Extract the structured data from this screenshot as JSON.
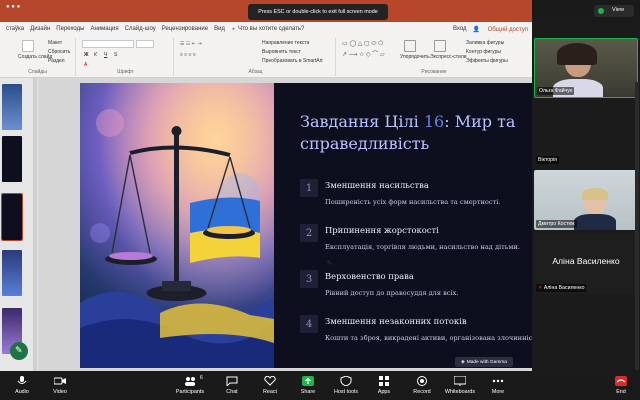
{
  "zoom_banner": "Press ESC or double-click to exit full screen mode",
  "view_label": "View",
  "menu": [
    "стаўка",
    "Дизайн",
    "Переходы",
    "Анимация",
    "Слайд-шоу",
    "Рецензирование",
    "Вид",
    "Что вы хотите сделать?"
  ],
  "menu_right": [
    "Вход",
    "Общий доступ"
  ],
  "ribbon": {
    "create_slide": "Создать слайд",
    "layout": "Макет",
    "reset": "Сбросить",
    "section": "Раздел",
    "text_direction": "Направление текста",
    "align_text": "Выровнять текст",
    "convert_smartart": "Преобразовать в SmartArt",
    "arrange": "Упорядочить",
    "quick_styles": "Экспресс-стили",
    "shape_fill": "Заливка фигуры",
    "shape_outline": "Контур фигуры",
    "shape_effects": "Эффекты фигуры",
    "group_slides": "Слайды",
    "group_font": "Шрифт",
    "group_paragraph": "Абзац",
    "group_drawing": "Рисование"
  },
  "thumb_numbers": [
    "",
    "",
    "",
    "",
    "",
    ""
  ],
  "slide": {
    "title_a": "Завдання Цілі ",
    "title_hl": "16",
    "title_b": ": Мир та справедливість",
    "items": [
      {
        "num": "1",
        "title": "Зменшення насильства",
        "desc": "Поширеність усіх форм насильства та смертності."
      },
      {
        "num": "2",
        "title": "Припинення жорстокості",
        "desc": "Експлуатація, торгівля людьми, насильство над дітьми."
      },
      {
        "num": "3",
        "title": "Верховенство права",
        "desc": "Рівний доступ до правосуддя для всіх."
      },
      {
        "num": "4",
        "title": "Зменшення незаконних потоків",
        "desc": "Кошти та зброя, викрадені активи, організована злочинність."
      }
    ],
    "badge": "Made with Gamma"
  },
  "participants": [
    {
      "name": "Ольга Файчук"
    },
    {
      "name": "Вікторія"
    },
    {
      "name": "Дмитро Костюк"
    },
    {
      "name": "Аліна Василенко",
      "big": "Аліна Василенко"
    }
  ],
  "toolbar": [
    {
      "label": "Audio",
      "icon": "microphone-icon"
    },
    {
      "label": "Video",
      "icon": "video-camera-icon"
    },
    {
      "label": "Participants",
      "icon": "participants-icon",
      "count": "6"
    },
    {
      "label": "Chat",
      "icon": "chat-icon"
    },
    {
      "label": "React",
      "icon": "heart-icon"
    },
    {
      "label": "Share",
      "icon": "share-arrow-icon"
    },
    {
      "label": "Host tools",
      "icon": "shield-icon"
    },
    {
      "label": "Apps",
      "icon": "apps-icon"
    },
    {
      "label": "Record",
      "icon": "record-icon"
    },
    {
      "label": "Whiteboards",
      "icon": "whiteboard-icon"
    },
    {
      "label": "More",
      "icon": "more-icon"
    },
    {
      "label": "End",
      "icon": "end-icon"
    }
  ],
  "colors": {
    "accent": "#b7472a",
    "share": "#1bb74a",
    "end": "#e02828",
    "slide_bg": "#0d0f1e"
  }
}
